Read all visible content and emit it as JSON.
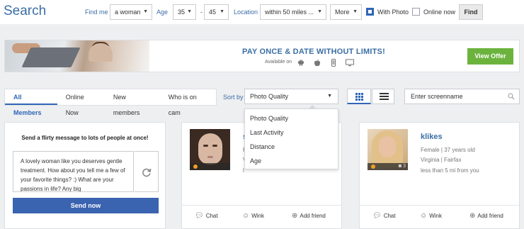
{
  "search": {
    "title": "Search",
    "find_me_label": "Find me",
    "find_me_value": "a woman",
    "age_label": "Age",
    "age_min": "35",
    "age_sep": "-",
    "age_max": "45",
    "location_label": "Location",
    "location_value": "within 50 miles ...",
    "more_label": "More",
    "with_photo_label": "With Photo",
    "with_photo_checked": true,
    "online_now_label": "Online now",
    "online_now_checked": false,
    "find_button": "Find"
  },
  "banner": {
    "title": "PAY ONCE & DATE WITHOUT LIMITS!",
    "available_on": "Available on",
    "platforms": [
      "android-icon",
      "apple-icon",
      "mobile-icon",
      "desktop-icon"
    ],
    "offer_button": "View Offer"
  },
  "tabs": [
    {
      "label": "All Members",
      "active": true
    },
    {
      "label": "Online Now",
      "active": false
    },
    {
      "label": "New members",
      "active": false
    },
    {
      "label": "Who is on cam",
      "active": false
    }
  ],
  "sort": {
    "label": "Sort by",
    "selected": "Photo Quality",
    "options": [
      "Photo Quality",
      "Last Activity",
      "Distance",
      "Age"
    ]
  },
  "screenname": {
    "placeholder": "Enter screenname"
  },
  "message_card": {
    "title": "Send a flirty message to lots of people at once!",
    "text": "A lovely woman like you deserves gentle treatment. How about you tell me a few of your favorite things? :) What are your passions in life? Any big",
    "send_button": "Send now"
  },
  "profiles": [
    {
      "name": "s",
      "line1": "F",
      "line2": "V",
      "line3": "l",
      "photo_count": "",
      "actions": {
        "chat": "Chat",
        "wink": "Wink",
        "add_friend": "Add friend"
      }
    },
    {
      "name": "klikes",
      "line1": "Female | 37 years old",
      "line2": "Virginia | Fairfax",
      "line3": "less than 5 mi from you",
      "photo_count": "3",
      "actions": {
        "chat": "Chat",
        "wink": "Wink",
        "add_friend": "Add friend"
      }
    }
  ],
  "colors": {
    "accent": "#3b6ea5",
    "primary_button": "#3a63b0",
    "offer_button": "#6cb33e",
    "online_dot": "#f0a020"
  }
}
